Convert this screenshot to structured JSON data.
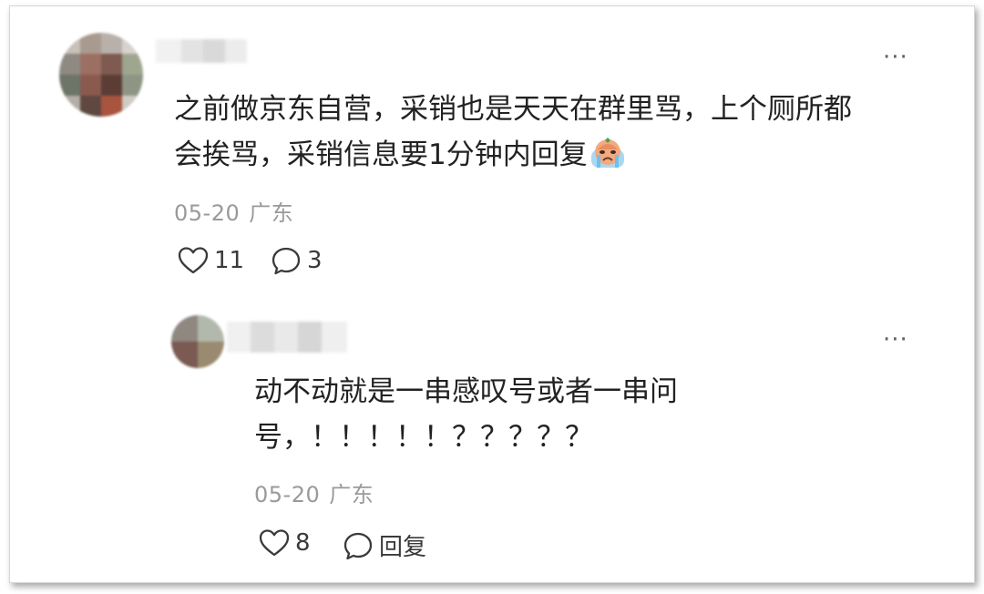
{
  "comment": {
    "text_line1": "之前做京东自营，采销也是天天在群里骂，上个厕所都",
    "text_line2": "会挨骂，采销信息要1分钟内回复",
    "emoji": "crying-face-emoji",
    "date": "05-20",
    "location": "广东",
    "likes": "11",
    "replies": "3",
    "more_label": "···"
  },
  "reply": {
    "text_line1": "动不动就是一串感叹号或者一串问",
    "text_line2": "号，！！！！！？？？？？",
    "date": "05-20",
    "location": "广东",
    "likes": "8",
    "reply_label": "回复",
    "more_label": "···"
  },
  "colors": {
    "text": "#222222",
    "meta": "#9a9a9a",
    "icon": "#3a3a3a"
  }
}
